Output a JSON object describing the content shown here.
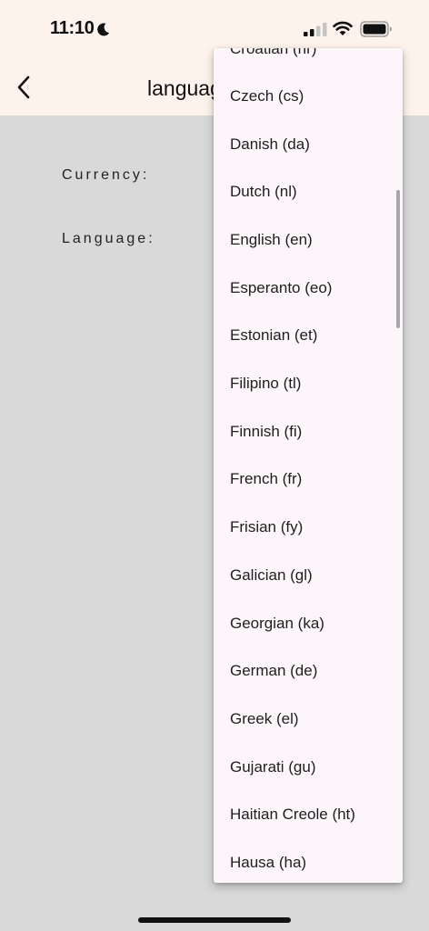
{
  "status_bar": {
    "time": "11:10",
    "icons": [
      "moon-icon",
      "signal-icon",
      "wifi-icon",
      "battery-icon"
    ]
  },
  "app_bar": {
    "back_icon": "chevron-left-icon",
    "title": "languag"
  },
  "form": {
    "currency_label": "Currency:",
    "language_label": "Language:"
  },
  "language_dropdown": {
    "options": [
      "Croatian (hr)",
      "Czech (cs)",
      "Danish (da)",
      "Dutch (nl)",
      "English (en)",
      "Esperanto (eo)",
      "Estonian (et)",
      "Filipino (tl)",
      "Finnish (fi)",
      "French (fr)",
      "Frisian (fy)",
      "Galician (gl)",
      "Georgian (ka)",
      "German (de)",
      "Greek (el)",
      "Gujarati (gu)",
      "Haitian Creole (ht)",
      "Hausa (ha)"
    ]
  },
  "colors": {
    "app_bar_background": "#fdf3ec",
    "body_background": "#d9d9d9",
    "menu_background": "#fcf6fb"
  }
}
